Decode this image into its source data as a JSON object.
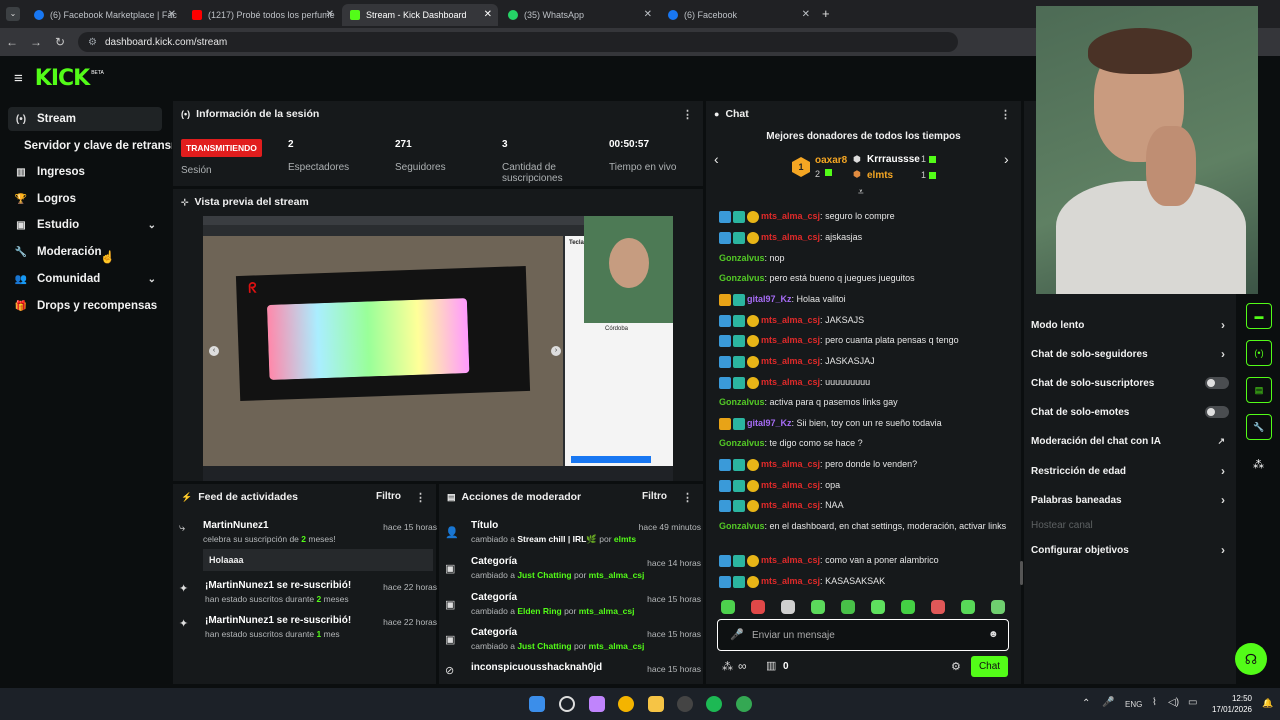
{
  "browser": {
    "tabs": [
      {
        "label": "(6) Facebook Marketplace | Fac",
        "color": "#1877f2"
      },
      {
        "label": "(1217) Probé todos los perfume",
        "color": "#ff0000"
      },
      {
        "label": "Stream - Kick Dashboard",
        "color": "#53fc18"
      },
      {
        "label": "(35) WhatsApp",
        "color": "#25d366"
      },
      {
        "label": "(6) Facebook",
        "color": "#1877f2"
      }
    ],
    "new_tab": "+",
    "url": "dashboard.kick.com/stream"
  },
  "header": {
    "logo": "KICK",
    "beta": "BETA"
  },
  "sidebar": {
    "items": [
      {
        "label": "Stream",
        "icon": "(•)"
      },
      {
        "label": "Servidor y clave de retransm",
        "icon": ""
      },
      {
        "label": "Ingresos",
        "icon": "▥"
      },
      {
        "label": "Logros",
        "icon": "🏆"
      },
      {
        "label": "Estudio",
        "icon": "▣"
      },
      {
        "label": "Moderación",
        "icon": "🔧"
      },
      {
        "label": "Comunidad",
        "icon": "👥"
      },
      {
        "label": "Drops y recompensas",
        "icon": "🎁"
      }
    ]
  },
  "session": {
    "title": "Información de la sesión",
    "status": "TRANSMITIENDO",
    "status_label": "Sesión",
    "stats": [
      {
        "value": "2",
        "label": "Espectadores"
      },
      {
        "value": "271",
        "label": "Seguidores"
      },
      {
        "value": "3",
        "label": "Cantidad de suscripciones"
      },
      {
        "value": "00:50:57",
        "label": "Tiempo en vivo"
      }
    ]
  },
  "preview": {
    "title": "Vista previa del stream",
    "city": "Córdoba",
    "brand": "Tecla Redr"
  },
  "feed": {
    "title": "Feed de actividades",
    "filter": "Filtro",
    "items": [
      {
        "name": "MartinNunez1",
        "sub_a": "celebra su suscripción de ",
        "highlight": "2",
        "sub_b": " meses!",
        "time": "hace 15 horas",
        "message": "Holaaaa"
      },
      {
        "name": "¡MartinNunez1 se re-suscribió!",
        "sub_a": "han estado suscritos durante ",
        "highlight": "2",
        "sub_b": " meses",
        "time": "hace 22 horas"
      },
      {
        "name": "¡MartinNunez1 se re-suscribió!",
        "sub_a": "han estado suscritos durante ",
        "highlight": "1",
        "sub_b": " mes",
        "time": "hace 22 horas"
      }
    ]
  },
  "modactions": {
    "title": "Acciones de moderador",
    "filter": "Filtro",
    "items": [
      {
        "name": "Título",
        "sub_a": "cambiado a ",
        "value": "Stream chill | IRL🌿",
        "by": " por ",
        "user": "elmts",
        "time": "hace 49 minutos"
      },
      {
        "name": "Categoría",
        "sub_a": "cambiado a ",
        "value": "Just Chatting",
        "by": " por ",
        "user": "mts_alma_csj",
        "time": "hace 14 horas"
      },
      {
        "name": "Categoría",
        "sub_a": "cambiado a ",
        "value": "Elden Ring",
        "by": " por ",
        "user": "mts_alma_csj",
        "time": "hace 15 horas"
      },
      {
        "name": "Categoría",
        "sub_a": "cambiado a ",
        "value": "Just Chatting",
        "by": " por ",
        "user": "mts_alma_csj",
        "time": "hace 15 horas"
      },
      {
        "name": "inconspicuousshacknah0jd",
        "sub_a": "",
        "value": "",
        "by": "",
        "user": "",
        "time": "hace 15 horas"
      }
    ]
  },
  "chat": {
    "title": "Chat",
    "donors_title": "Mejores donadores de todos los tiempos",
    "donors": [
      {
        "rank": "1",
        "name": "oaxar8",
        "count": "2"
      },
      {
        "name": "Krrraussse",
        "count": "1"
      },
      {
        "name": "elmts",
        "count": "1"
      }
    ],
    "messages": [
      {
        "user": "mts_alma_csj",
        "color": "red",
        "text": "seguro lo compre"
      },
      {
        "user": "mts_alma_csj",
        "color": "red",
        "text": "ajskasjas"
      },
      {
        "user": "Gonzalvus",
        "color": "green",
        "text": "nop"
      },
      {
        "user": "Gonzalvus",
        "color": "green",
        "text": "pero está bueno q juegues jueguitos"
      },
      {
        "user": "gital97_Kz",
        "color": "purple",
        "text": "Holaa valitoi"
      },
      {
        "user": "mts_alma_csj",
        "color": "red",
        "text": "JAKSAJS"
      },
      {
        "user": "mts_alma_csj",
        "color": "red",
        "text": "pero cuanta plata pensas q tengo"
      },
      {
        "user": "mts_alma_csj",
        "color": "red",
        "text": "JASKASJAJ"
      },
      {
        "user": "mts_alma_csj",
        "color": "red",
        "text": "uuuuuuuuu"
      },
      {
        "user": "Gonzalvus",
        "color": "green",
        "text": "activa para q pasemos links gay"
      },
      {
        "user": "gital97_Kz",
        "color": "purple",
        "text": "Sii bien, toy con un re sueño todavia"
      },
      {
        "user": "Gonzalvus",
        "color": "green",
        "text": "te digo como se hace ?"
      },
      {
        "user": "mts_alma_csj",
        "color": "red",
        "text": "pero donde lo venden?"
      },
      {
        "user": "mts_alma_csj",
        "color": "red",
        "text": "opa"
      },
      {
        "user": "mts_alma_csj",
        "color": "red",
        "text": "NAA"
      },
      {
        "user": "Gonzalvus",
        "color": "green",
        "text": "en el dashboard, en chat settings, moderación, activar links"
      },
      {
        "user": "mts_alma_csj",
        "color": "red",
        "text": "como van a poner alambrico"
      },
      {
        "user": "mts_alma_csj",
        "color": "red",
        "text": "KASASAKSAK"
      }
    ],
    "input_placeholder": "Enviar un mensaje",
    "infinity": "∞",
    "count": "0",
    "send": "Chat"
  },
  "settings": {
    "options": [
      {
        "label": "Modo lento",
        "control": "arrow"
      },
      {
        "label": "Chat de solo-seguidores",
        "control": "arrow"
      },
      {
        "label": "Chat de solo-suscriptores",
        "control": "toggle"
      },
      {
        "label": "Chat de solo-emotes",
        "control": "toggle"
      },
      {
        "label": "Moderación del chat con IA",
        "control": "external"
      },
      {
        "label": "Restricción de edad",
        "control": "arrow"
      },
      {
        "label": "Palabras baneadas",
        "control": "arrow"
      },
      {
        "label": "Hostear canal",
        "control": "disabled"
      },
      {
        "label": "Configurar objetivos",
        "control": "arrow"
      }
    ]
  },
  "taskbar": {
    "lang": "ENG",
    "time": "12:50",
    "date": "17/01/2026"
  },
  "colors": {
    "kick_green": "#53fc18",
    "live_red": "#e11d1d",
    "panel_bg": "#16191b",
    "page_bg": "#0b0e0f"
  }
}
